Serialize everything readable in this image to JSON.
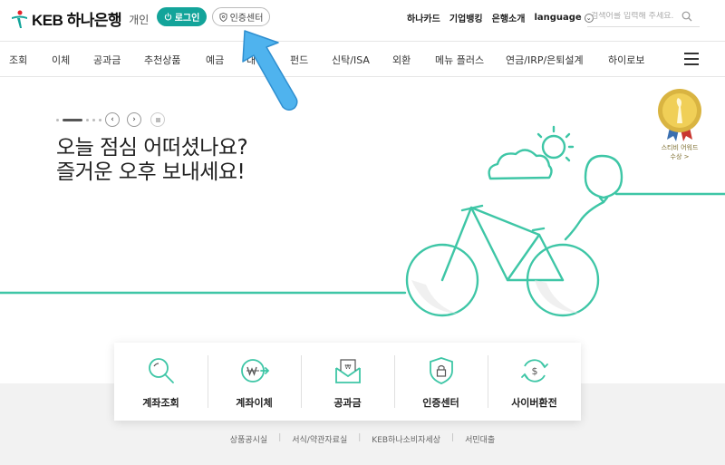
{
  "header": {
    "logo_text": "KEB 하나은행",
    "logo_sub": "개인",
    "login_label": "로그인",
    "cert_label": "인증센터",
    "top_links": [
      "하나카드",
      "기업뱅킹",
      "은행소개"
    ],
    "language_label": "language",
    "search_placeholder": "검색어를 입력해 주세요."
  },
  "nav": {
    "items": [
      "조회",
      "이체",
      "공과금",
      "추천상품",
      "예금",
      "대",
      "펀드",
      "신탁/ISA",
      "외환",
      "메뉴 플러스",
      "연금/IRP/은퇴설계",
      "하이로보"
    ]
  },
  "hero": {
    "line1": "오늘 점심 어떠셨나요?",
    "line2": "즐거운 오후 보내세요!",
    "award_line1": "스티비 어워드",
    "award_line2": "수상 >"
  },
  "quick_menu": {
    "items": [
      "계좌조회",
      "계좌이체",
      "공과금",
      "인증센터",
      "사이버환전"
    ]
  },
  "footer": {
    "links": [
      "상품공시실",
      "서식/약관자료실",
      "KEB하나소비자세상",
      "서민대출"
    ]
  },
  "colors": {
    "brand": "#13a49a",
    "line": "#3ec6a6"
  }
}
